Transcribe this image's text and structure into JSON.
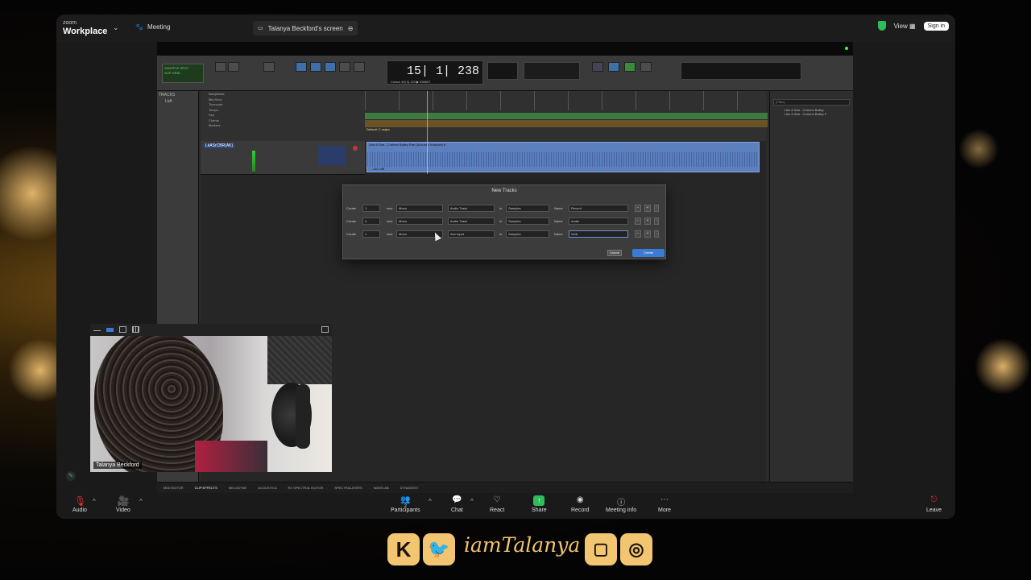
{
  "zoom": {
    "brand_small": "zoom",
    "brand_big": "Workplace",
    "meeting_tab": "Meeting",
    "share_tab": "Talanya Beckford's screen",
    "view_label": "View",
    "signin_label": "Sign in",
    "bottom": {
      "audio": "Audio",
      "video": "Video",
      "participants": "Participants",
      "participants_count": "2",
      "chat": "Chat",
      "react": "React",
      "share": "Share",
      "record": "Record",
      "meeting_info": "Meeting info",
      "more": "More",
      "leave": "Leave"
    }
  },
  "protools": {
    "counter_main": "15| 1| 238",
    "counter_sub": "Cursor   45| 3| 123   ▶   936607",
    "left_panel_title": "TRACKS",
    "left_panel_item": "LkA",
    "rulers": [
      "Bars|Beats",
      "Min:Secs",
      "Timecode",
      "Tempo",
      "Key",
      "Chords",
      "Markers"
    ],
    "tempo_value": "108",
    "key_value": "Default: C major",
    "track_name": "LkASrCBR(AK)",
    "clip_title": "Like A Star - Corinne Bailey Rae (Acoustic Karaoke) #",
    "clip_db": "-18.1 dB",
    "right_panel_filter": "(Filter)",
    "right_panel_items": [
      "Like A Star - Corinne Bailey",
      "Like A Star - Corinne Bailey F"
    ],
    "bottom_tabs": [
      "MIDI EDITOR",
      "CLIP EFFECTS",
      "MELODYNE",
      "ACOUSTICA",
      "RX SPECTRAL EDITOR",
      "SPECTRALAYERS",
      "WAVELAB",
      "DYNASSIST"
    ]
  },
  "dialog": {
    "title": "New Tracks",
    "rows": [
      {
        "create": "Create",
        "count": "1",
        "new": "new",
        "format": "Mono",
        "type": "Audio Track",
        "in": "in",
        "timebase": "Samples",
        "name_label": "Name",
        "name": "Record"
      },
      {
        "create": "Create",
        "count": "4",
        "new": "new",
        "format": "Mono",
        "type": "Audio Track",
        "in": "in",
        "timebase": "Samples",
        "name_label": "Name",
        "name": "Audio"
      },
      {
        "create": "Create",
        "count": "1",
        "new": "new",
        "format": "Mono",
        "type": "Aux Input",
        "in": "in",
        "timebase": "Samples",
        "name_label": "Name",
        "name": "Verb"
      }
    ],
    "cancel": "Cancel",
    "create_button": "Create"
  },
  "webcam": {
    "name": "Talanya Beckford"
  },
  "overlay": {
    "handle": "iamTalanya",
    "icons": [
      "kick-icon",
      "twitter-icon",
      "twitch-icon",
      "instagram-icon"
    ]
  },
  "colors": {
    "accent_gold": "#f2c571",
    "zoom_bg": "#1a1a1a",
    "share_green": "#2ebd59",
    "create_blue": "#3a7bd5",
    "clip_blue": "#5c7fbe"
  }
}
